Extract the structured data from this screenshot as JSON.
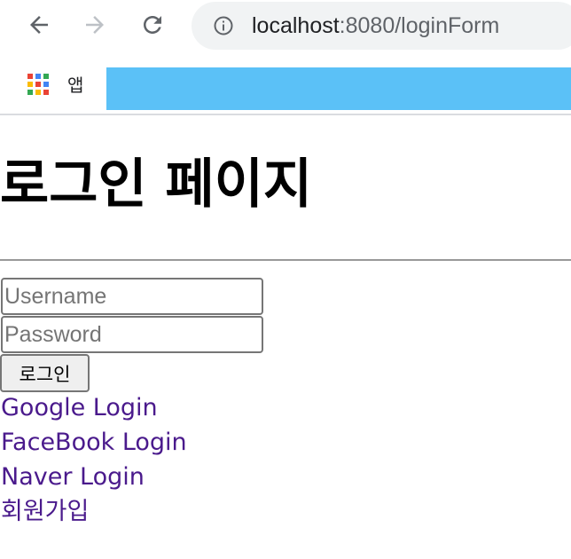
{
  "browser": {
    "url_host": "localhost",
    "url_rest": ":8080/loginForm",
    "bookmarks": {
      "apps_label": "앱"
    },
    "colors": {
      "bookmark_blue": "#5bc1f7",
      "omnibox_bg": "#f1f3f4"
    },
    "icons": {
      "back": "arrow-left-icon",
      "forward": "arrow-right-icon",
      "reload": "reload-icon",
      "info": "info-icon",
      "apps": "apps-grid-icon"
    }
  },
  "page": {
    "title": "로그인 페이지",
    "username_placeholder": "Username",
    "password_placeholder": "Password",
    "login_button": "로그인",
    "links": {
      "google": "Google Login",
      "facebook": "FaceBook Login",
      "naver": "Naver Login",
      "signup": "회원가입"
    },
    "link_color": "#4a1a8c"
  }
}
